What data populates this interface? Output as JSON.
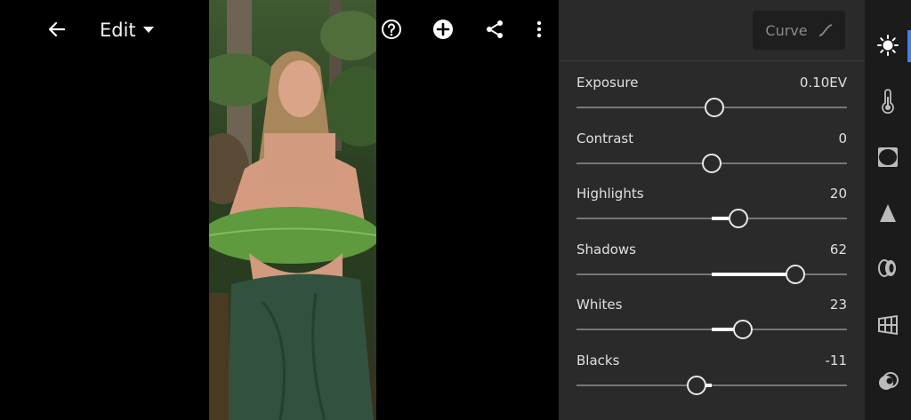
{
  "toolbar": {
    "mode_label": "Edit",
    "icons": [
      "back-arrow-icon",
      "undo-icon",
      "help-icon",
      "add-icon",
      "share-icon",
      "more-icon"
    ]
  },
  "panel": {
    "curve_label": "Curve",
    "sliders": [
      {
        "name": "Exposure",
        "value": "0.10EV",
        "position": 0.51
      },
      {
        "name": "Contrast",
        "value": "0",
        "position": 0.5
      },
      {
        "name": "Highlights",
        "value": "20",
        "position": 0.6
      },
      {
        "name": "Shadows",
        "value": "62",
        "position": 0.81
      },
      {
        "name": "Whites",
        "value": "23",
        "position": 0.615
      },
      {
        "name": "Blacks",
        "value": "-11",
        "position": 0.445
      }
    ]
  },
  "side_rail": {
    "icons": [
      "light-icon",
      "color-icon",
      "effects-icon",
      "detail-icon",
      "optics-icon",
      "geometry-icon",
      "mix-icon"
    ],
    "active": "light-icon"
  },
  "colors": {
    "panel_bg": "#2a2a2a",
    "rail_bg": "#1b1b1b",
    "accent": "#3b82f6"
  }
}
